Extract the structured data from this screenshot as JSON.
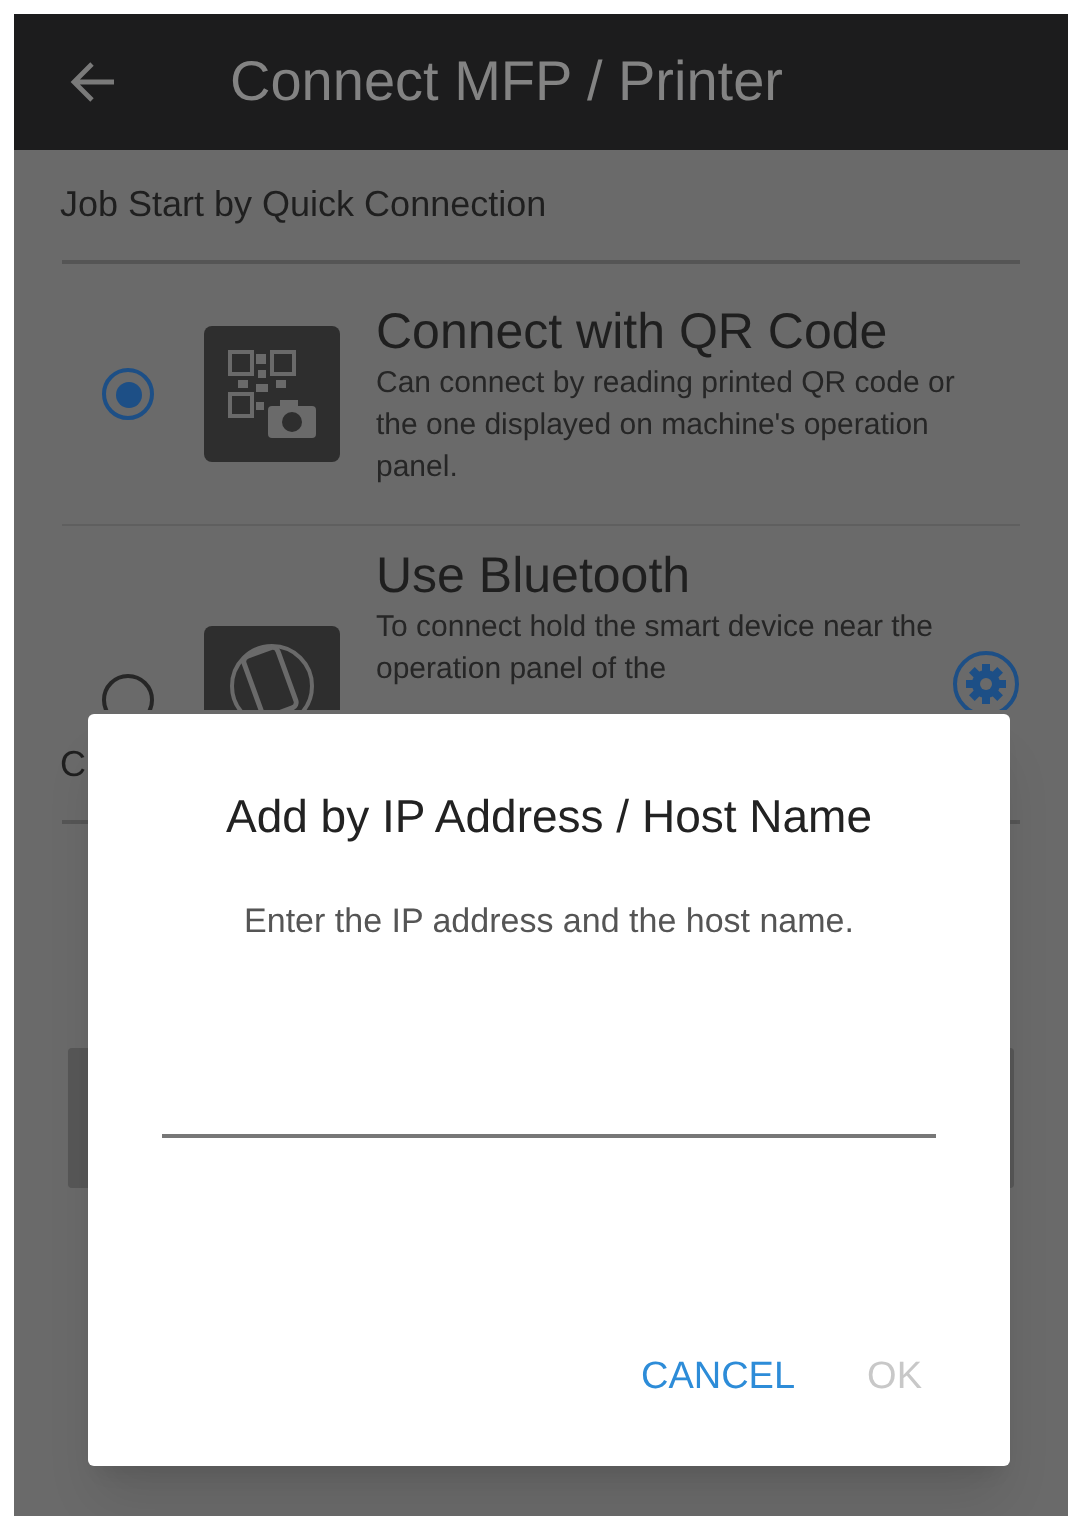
{
  "app_bar": {
    "title": "Connect MFP / Printer"
  },
  "sections": [
    {
      "heading": "Job Start by Quick Connection",
      "options": [
        {
          "kind": "qr",
          "title": "Connect with QR Code",
          "description": "Can connect by reading printed QR code or the one displayed on machine's operation panel.",
          "selected": true
        },
        {
          "kind": "bluetooth",
          "title": "Use Bluetooth",
          "description": "To connect hold the smart device near the operation panel of the",
          "selected": false
        }
      ]
    },
    {
      "heading": "C"
    }
  ],
  "dialog": {
    "title": "Add by IP Address / Host Name",
    "message": "Enter the IP address and the host name.",
    "buttons": [
      {
        "label": "CANCEL",
        "disabled": false
      },
      {
        "label": "OK",
        "disabled": true
      }
    ]
  }
}
